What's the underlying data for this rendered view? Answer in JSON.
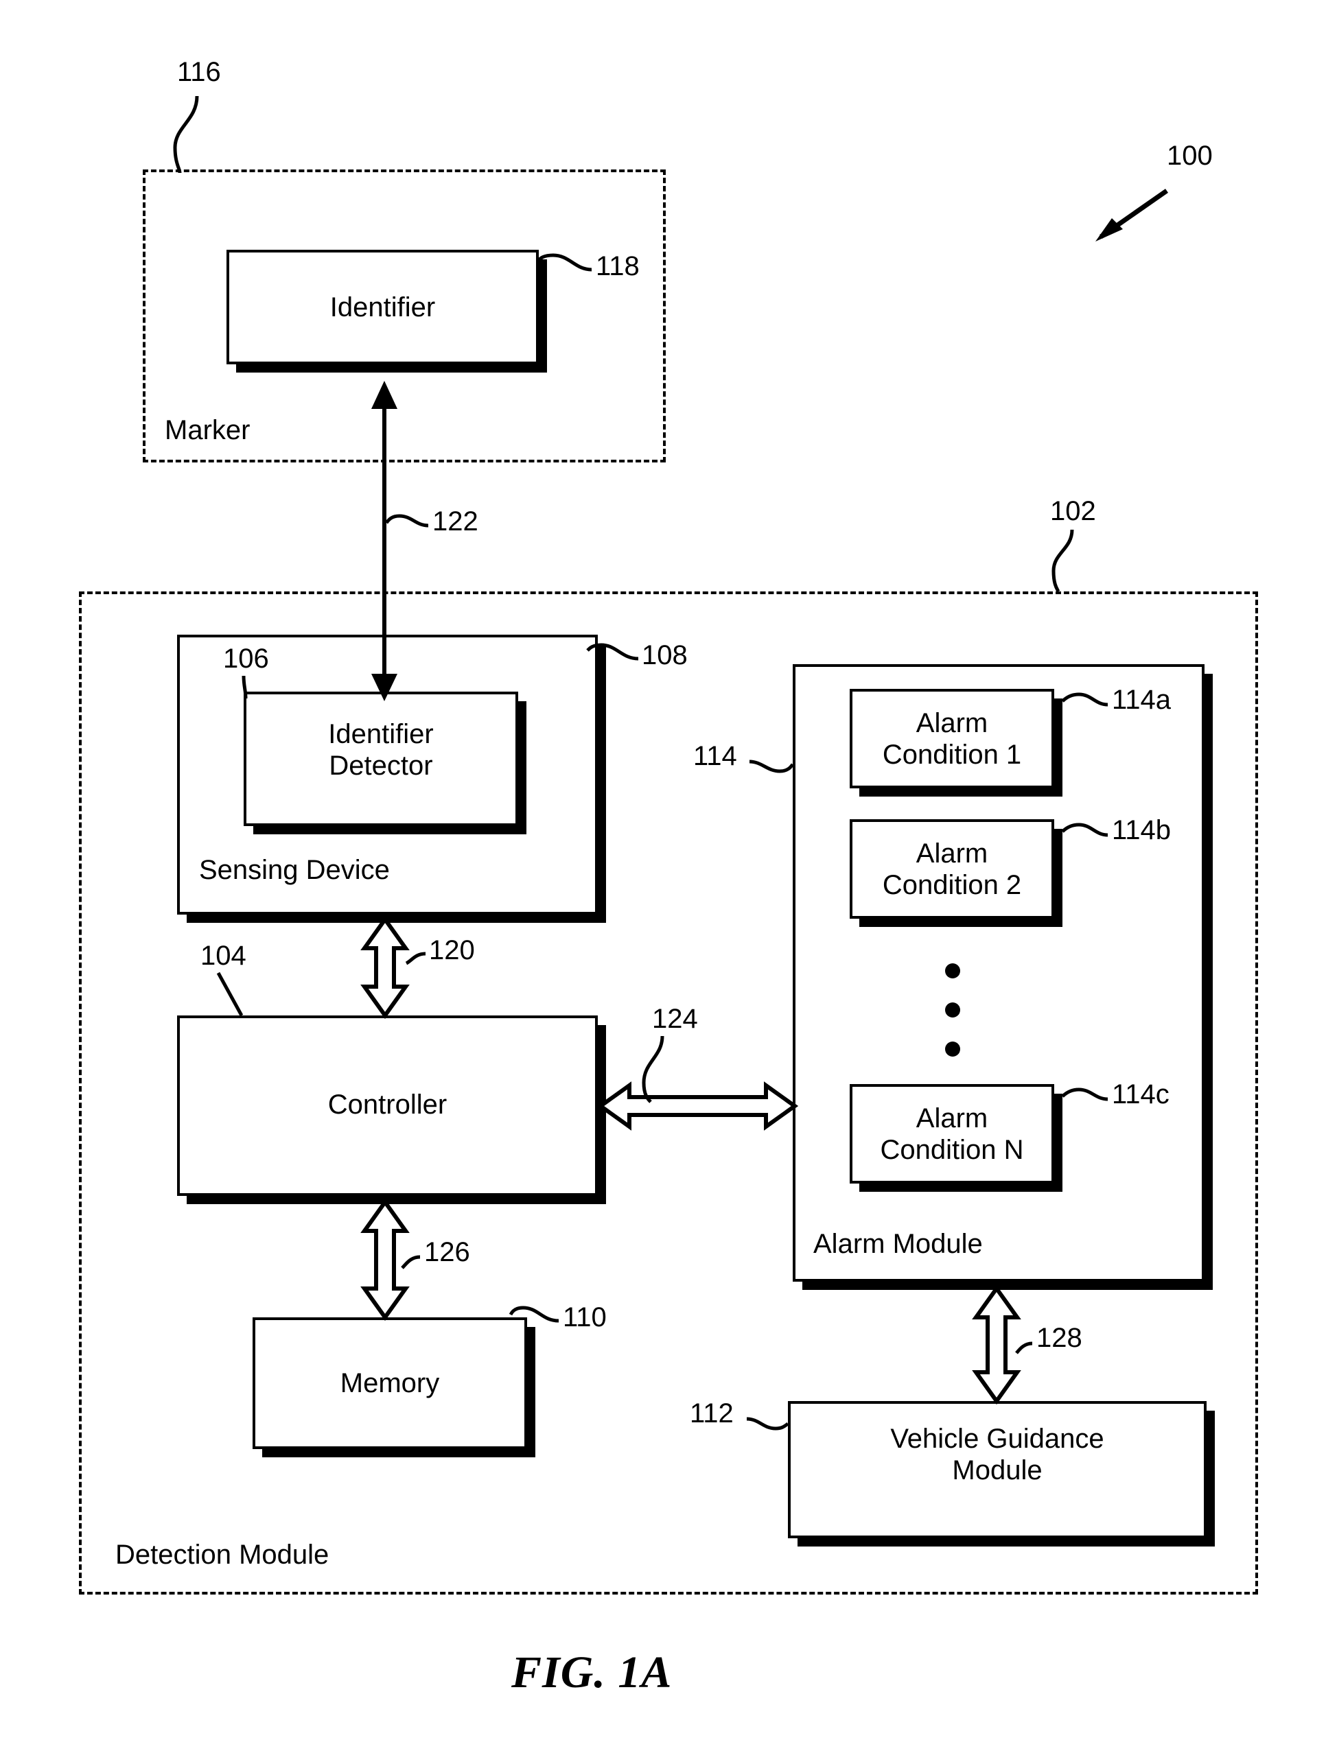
{
  "figure": {
    "title": "FIG. 1A",
    "system_ref": "100"
  },
  "marker_group": {
    "ref": "116",
    "label": "Marker",
    "identifier_box": {
      "label": "Identifier",
      "ref": "118"
    }
  },
  "detection_module": {
    "ref": "102",
    "label": "Detection Module",
    "sensing_device": {
      "label": "Sensing Device",
      "ref": "108",
      "identifier_detector": {
        "label": "Identifier\nDetector",
        "ref": "106"
      }
    },
    "controller": {
      "label": "Controller",
      "ref": "104"
    },
    "memory": {
      "label": "Memory",
      "ref": "110"
    },
    "alarm_module": {
      "label": "Alarm Module",
      "ref": "114",
      "conditions": [
        {
          "label": "Alarm\nCondition 1",
          "ref": "114a"
        },
        {
          "label": "Alarm\nCondition 2",
          "ref": "114b"
        },
        {
          "label": "Alarm\nCondition N",
          "ref": "114c"
        }
      ]
    },
    "vehicle_guidance_module": {
      "label": "Vehicle Guidance\nModule",
      "ref": "112"
    }
  },
  "connectors": [
    {
      "ref": "122",
      "from": "identifier-detector",
      "to": "identifier"
    },
    {
      "ref": "120",
      "from": "sensing-device",
      "to": "controller"
    },
    {
      "ref": "124",
      "from": "controller",
      "to": "alarm-module"
    },
    {
      "ref": "126",
      "from": "controller",
      "to": "memory"
    },
    {
      "ref": "128",
      "from": "alarm-module",
      "to": "vehicle-guidance-module"
    }
  ]
}
